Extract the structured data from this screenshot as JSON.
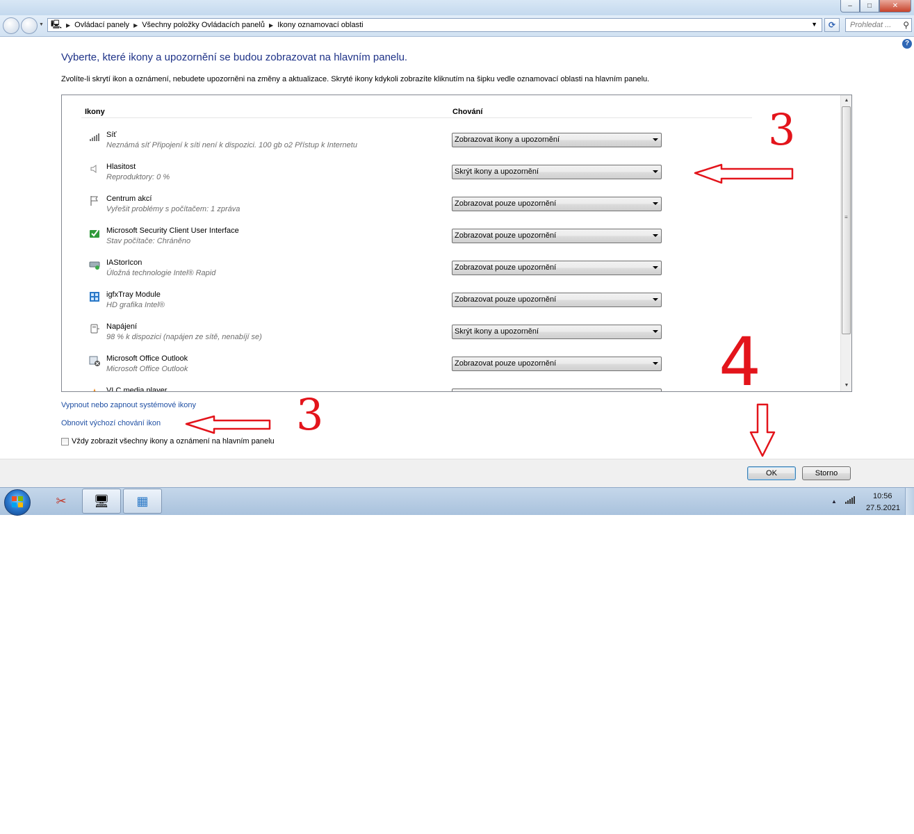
{
  "window": {
    "controls": {
      "minimize": "–",
      "maximize": "□",
      "close": "✕"
    }
  },
  "address_bar": {
    "crumbs": [
      "Ovládací panely",
      "Všechny položky Ovládacích panelů",
      "Ikony oznamovací oblasti"
    ],
    "search_placeholder": "Prohledat ..."
  },
  "page": {
    "title": "Vyberte, které ikony a upozornění se budou zobrazovat na hlavním panelu.",
    "description": "Zvolíte-li skrytí ikon a oznámení, nebudete upozorněni na změny a aktualizace. Skryté ikony kdykoli zobrazíte kliknutím na šipku vedle oznamovací oblasti na hlavním panelu."
  },
  "table": {
    "col_icons": "Ikony",
    "col_behavior": "Chování",
    "rows": [
      {
        "name": "Síť",
        "sub": "Neznámá síť Připojení k síti není k dispozici. 100 gb o2 Přístup k Internetu",
        "behavior": "Zobrazovat ikony a upozornění",
        "icon": "signal-bars-icon"
      },
      {
        "name": "Hlasitost",
        "sub": "Reproduktory: 0 %",
        "behavior": "Skrýt ikony a upozornění",
        "icon": "speaker-icon"
      },
      {
        "name": "Centrum akcí",
        "sub": "Vyřešit problémy s počítačem: 1 zpráva",
        "behavior": "Zobrazovat pouze upozornění",
        "icon": "flag-icon"
      },
      {
        "name": "Microsoft Security Client User Interface",
        "sub": "Stav počítače: Chráněno",
        "behavior": "Zobrazovat pouze upozornění",
        "icon": "shield-check-icon"
      },
      {
        "name": "IAStorIcon",
        "sub": "Úložná technologie Intel® Rapid",
        "behavior": "Zobrazovat pouze upozornění",
        "icon": "storage-icon"
      },
      {
        "name": "igfxTray Module",
        "sub": "HD grafika Intel®",
        "behavior": "Zobrazovat pouze upozornění",
        "icon": "graphics-icon"
      },
      {
        "name": "Napájení",
        "sub": "98 % k dispozici (napájen ze sítě, nenabíjí se)",
        "behavior": "Skrýt ikony a upozornění",
        "icon": "power-plug-icon"
      },
      {
        "name": "Microsoft Office Outlook",
        "sub": "Microsoft Office Outlook",
        "behavior": "Zobrazovat pouze upozornění",
        "icon": "outlook-icon"
      },
      {
        "name": "VLC media player",
        "sub": "",
        "behavior": "",
        "icon": "vlc-cone-icon"
      }
    ]
  },
  "links": {
    "system_icons": "Vypnout nebo zapnout systémové ikony",
    "restore_defaults": "Obnovit výchozí chování ikon",
    "always_show": "Vždy zobrazit všechny ikony a oznámení na hlavním panelu"
  },
  "buttons": {
    "ok": "OK",
    "cancel": "Storno"
  },
  "taskbar": {
    "time": "10:56",
    "date": "27.5.2021"
  },
  "annotations": {
    "marker_3_top": "3",
    "marker_3_bottom": "3",
    "marker_4": "4",
    "color": "#e3141b"
  },
  "help": "?"
}
